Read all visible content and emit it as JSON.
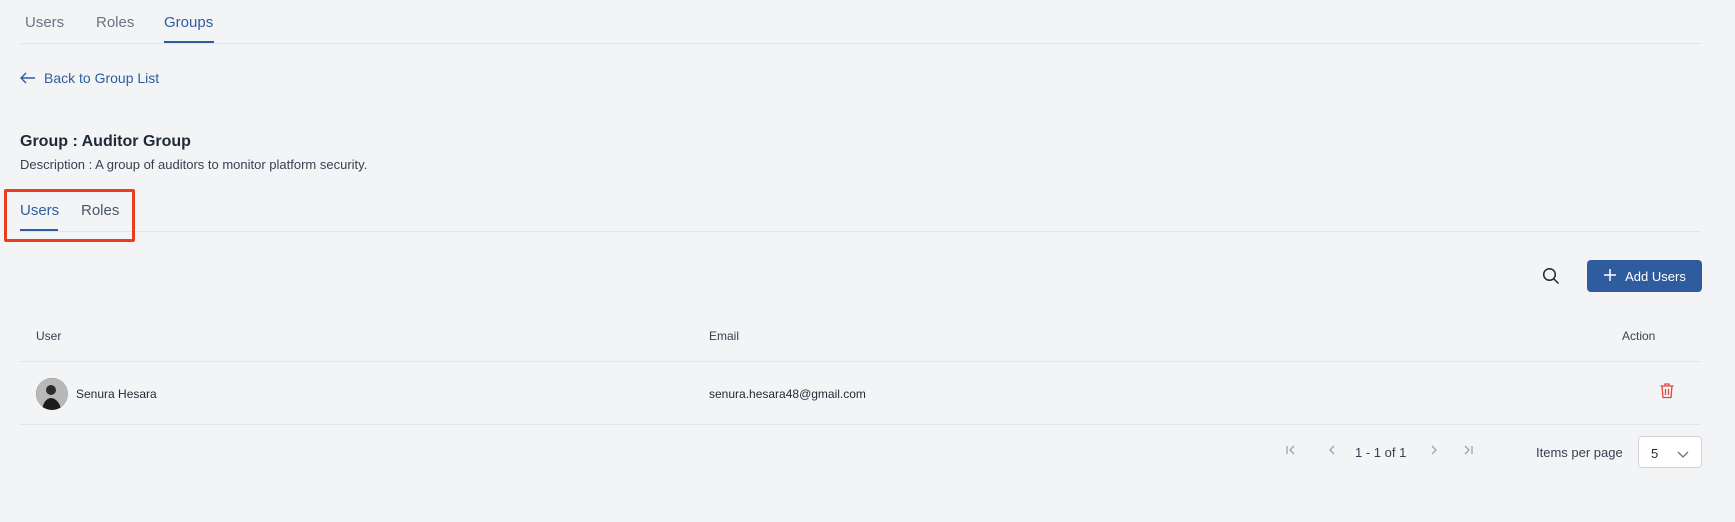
{
  "top_tabs": [
    {
      "label": "Users",
      "active": false
    },
    {
      "label": "Roles",
      "active": false
    },
    {
      "label": "Groups",
      "active": true
    }
  ],
  "back_link": {
    "label": "Back to Group List",
    "icon": "arrow-left-icon"
  },
  "group": {
    "title": "Group : Auditor Group",
    "description": "Description : A group of auditors to monitor platform security."
  },
  "inner_tabs": [
    {
      "label": "Users",
      "active": true
    },
    {
      "label": "Roles",
      "active": false
    }
  ],
  "toolbar": {
    "search_icon": "search-icon",
    "add_users_label": "Add Users",
    "add_icon": "plus-icon"
  },
  "table": {
    "headers": {
      "user": "User",
      "email": "Email",
      "action": "Action"
    },
    "rows": [
      {
        "name": "Senura Hesara",
        "email": "senura.hesara48@gmail.com",
        "action_icon": "trash-icon"
      }
    ]
  },
  "pagination": {
    "range_text": "1 - 1 of 1",
    "items_per_page_label": "Items per page",
    "items_per_page_value": "5"
  },
  "colors": {
    "accent": "#2e5c9e",
    "delete": "#e0463a",
    "highlight": "#e8401c",
    "background": "#f3f4f6"
  }
}
